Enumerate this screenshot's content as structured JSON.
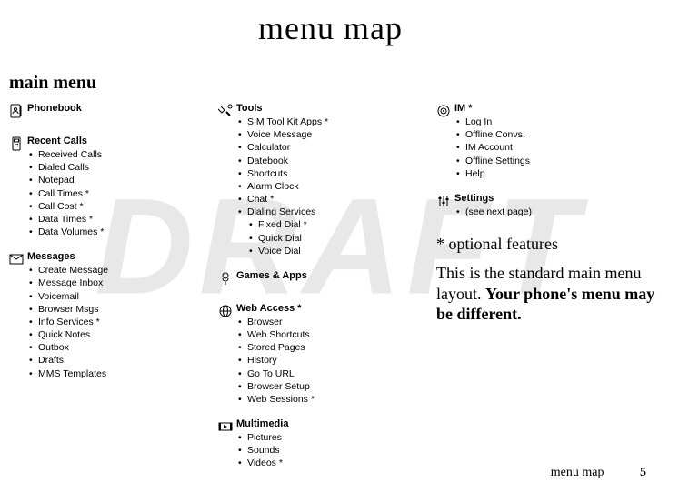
{
  "chapter_title": "menu map",
  "main_menu_label": "main menu",
  "draft_watermark": "DRAFT",
  "columns": [
    [
      {
        "icon": "phonebook-icon",
        "title": "Phonebook",
        "items": []
      },
      {
        "icon": "recent-calls-icon",
        "title": "Recent Calls",
        "items": [
          "Received Calls",
          "Dialed Calls",
          "Notepad",
          "Call Times *",
          "Call Cost *",
          "Data Times *",
          "Data Volumes *"
        ]
      },
      {
        "icon": "messages-icon",
        "title": "Messages",
        "items": [
          "Create Message",
          "Message Inbox",
          "Voicemail",
          "Browser Msgs",
          "Info Services *",
          "Quick Notes",
          "Outbox",
          "Drafts",
          "MMS Templates"
        ]
      }
    ],
    [
      {
        "icon": "tools-icon",
        "title": "Tools",
        "items": [
          "SIM Tool Kit Apps *",
          "Voice Message",
          "Calculator",
          "Datebook",
          "Shortcuts",
          "Alarm Clock",
          "Chat *",
          {
            "label": "Dialing Services",
            "sub": [
              "Fixed Dial *",
              "Quick Dial",
              "Voice Dial"
            ]
          }
        ]
      },
      {
        "icon": "games-icon",
        "title": "Games & Apps",
        "items": []
      },
      {
        "icon": "web-icon",
        "title": "Web Access *",
        "items": [
          "Browser",
          "Web Shortcuts",
          "Stored Pages",
          "History",
          "Go To URL",
          "Browser Setup",
          "Web Sessions *"
        ]
      },
      {
        "icon": "multimedia-icon",
        "title": "Multimedia",
        "items": [
          "Pictures",
          "Sounds",
          "Videos *"
        ]
      }
    ],
    [
      {
        "icon": "im-icon",
        "title": "IM *",
        "items": [
          "Log In",
          "Offline Convs.",
          "IM Account",
          "Offline Settings",
          "Help"
        ]
      },
      {
        "icon": "settings-icon",
        "title": "Settings",
        "items": [
          "(see next page)"
        ]
      }
    ]
  ],
  "asterisk_note": "* optional features",
  "layout_note_plain": "This is the standard main menu layout. ",
  "layout_note_bold": "Your phone's menu may be different.",
  "footer_label": "menu map",
  "page_number": "5"
}
